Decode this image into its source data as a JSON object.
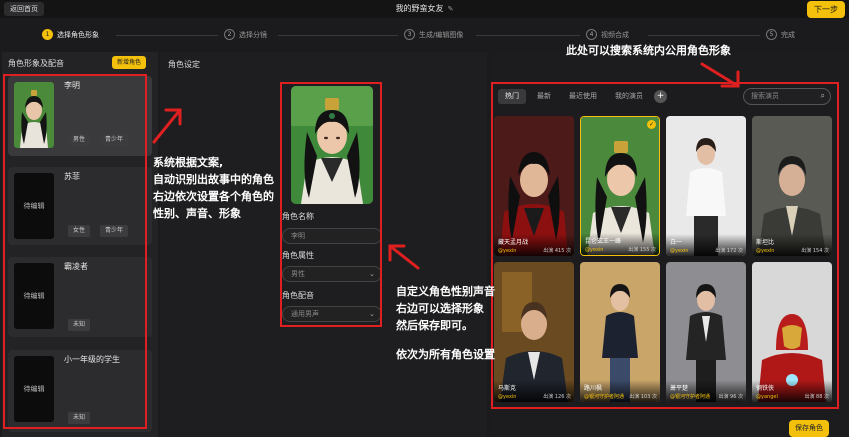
{
  "topbar": {
    "back_label": "返回首页",
    "project_title": "我的野蛮女友",
    "edit_icon": "pencil-icon",
    "next_label": "下一步"
  },
  "steps": [
    {
      "num": "1",
      "label": "选择角色形象",
      "active": true
    },
    {
      "num": "2",
      "label": "选择分镜",
      "active": false
    },
    {
      "num": "3",
      "label": "生成/编辑图像",
      "active": false
    },
    {
      "num": "4",
      "label": "视频合成",
      "active": false
    },
    {
      "num": "5",
      "label": "完成",
      "active": false
    }
  ],
  "left_panel": {
    "title": "角色形象及配音",
    "add_label": "新增角色",
    "roles": [
      {
        "name": "李明",
        "thumb": "",
        "tags": [
          "男性",
          "青少年"
        ]
      },
      {
        "name": "苏菲",
        "thumb": "待编辑",
        "tags": [
          "女性",
          "青少年"
        ]
      },
      {
        "name": "霸凌者",
        "thumb": "待编辑",
        "tags": [
          "未知"
        ]
      },
      {
        "name": "小一年级的学生",
        "thumb": "待编辑",
        "tags": [
          "未知"
        ]
      }
    ]
  },
  "mid_panel": {
    "title": "角色设定",
    "name_label": "角色名称",
    "name_value": "李明",
    "attr_label": "角色属性",
    "attr_value": "男性",
    "voice_label": "角色配音",
    "voice_value": "通用男声"
  },
  "right_panel": {
    "tabs": [
      "热门",
      "最新",
      "最近使用",
      "我的演员"
    ],
    "search_placeholder": "搜索演员",
    "characters": [
      {
        "name": "藏天孟月战",
        "author": "@yexin",
        "count": "出演 415 次"
      },
      {
        "name": "昆仑玄王一峰",
        "author": "@yexin",
        "count": "出演 155 次"
      },
      {
        "name": "白一",
        "author": "@yexin",
        "count": "出演 172 次"
      },
      {
        "name": "斯坦比",
        "author": "@yexin",
        "count": "出演 154 次"
      },
      {
        "name": "马斯克",
        "author": "@yexin",
        "count": "出演 126 次"
      },
      {
        "name": "路川枫",
        "author": "@银河守护者阿通",
        "count": "出演 103 次"
      },
      {
        "name": "萧平楚",
        "author": "@银河守护者阿通",
        "count": "出演 96 次"
      },
      {
        "name": "钢铁侠",
        "author": "@yangel",
        "count": "出演 88 次"
      }
    ]
  },
  "save_label": "保存角色",
  "annotations": {
    "top": "此处可以搜索系统内公用角色形象",
    "left": [
      "系统根据文案,",
      "自动识别出故事中的角色",
      "右边依次设置各个角色的",
      "性别、声音、形象"
    ],
    "mid": [
      "自定义角色性别声音",
      "右边可以选择形象",
      "然后保存即可。",
      "",
      "依次为所有角色设置"
    ]
  },
  "colors": {
    "accent": "#f3c00b",
    "annotation": "#e02020",
    "bg": "#1b1b1d"
  }
}
